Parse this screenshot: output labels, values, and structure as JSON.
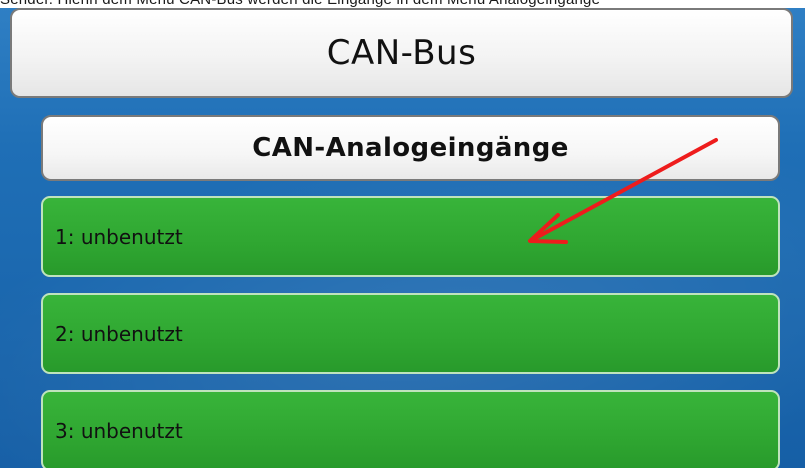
{
  "caption": {
    "text": "Sender. Hierin dem Menü CAN-Bus werden die Eingänge in dem Menü Analogeingänge"
  },
  "header": {
    "title": "CAN-Bus"
  },
  "section": {
    "title": "CAN-Analogeingänge"
  },
  "inputs": [
    {
      "label": "1: unbenutzt"
    },
    {
      "label": "2: unbenutzt"
    },
    {
      "label": "3: unbenutzt"
    }
  ],
  "colors": {
    "background": "#1f6fb6",
    "item_green": "#2fa631",
    "arrow_red": "#ee1c1c"
  },
  "annotation": {
    "icon": "red-arrow-icon"
  }
}
